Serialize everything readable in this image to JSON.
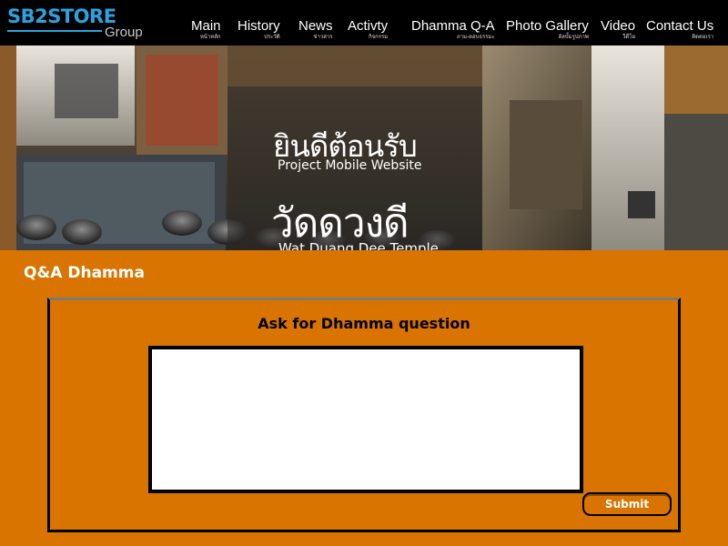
{
  "brand": {
    "name": "SB2STORE",
    "sub": "Group"
  },
  "nav": [
    {
      "label": "Main",
      "sub": "หน้าหลัก"
    },
    {
      "label": "History",
      "sub": "ประวัติ"
    },
    {
      "label": "News",
      "sub": "ข่าวสาร"
    },
    {
      "label": "Activty",
      "sub": "กิจกรรม"
    },
    {
      "label": "Dhamma Q-A",
      "sub": "ถาม-ตอบธรรมะ"
    },
    {
      "label": "Photo Gallery",
      "sub": "อัลบั้มรูปภาพ"
    },
    {
      "label": "Video",
      "sub": "วีดีโอ"
    },
    {
      "label": "Contact Us",
      "sub": "ติดต่อเรา"
    }
  ],
  "banner": {
    "welcome_thai": "ยินดีต้อนรับ",
    "welcome_en": "Project Mobile Website",
    "temple_thai": "วัดดวงดี",
    "temple_en": "Wat Duang Dee Temple"
  },
  "page": {
    "title": "Q&A Dhamma",
    "form_title": "Ask for Dhamma question",
    "question_value": "",
    "submit_label": "Submit"
  },
  "colors": {
    "accent": "#d97400",
    "header": "#000000",
    "logo": "#2aa3e0"
  }
}
